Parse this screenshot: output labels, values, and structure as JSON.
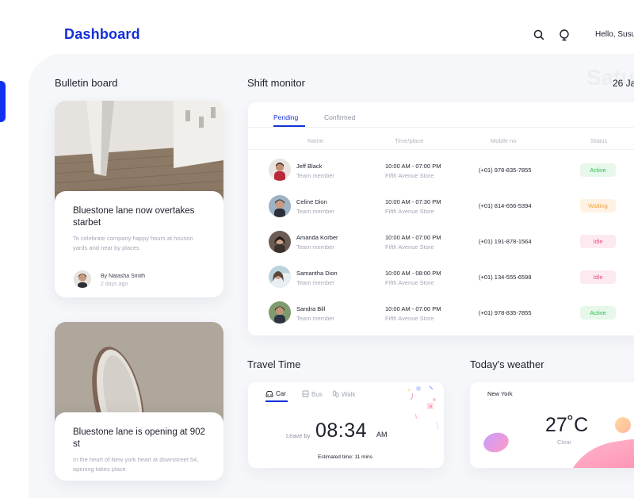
{
  "header": {
    "title": "Dashboard",
    "greeting": "Hello, Susu"
  },
  "bulletin": {
    "title": "Bulletin board",
    "cards": [
      {
        "title": "Bluestone lane now overtakes starbet",
        "excerpt": "To celebrate company happy hours at houson yards and near by places",
        "author": "By Natasha Smith",
        "time": "2 days ago"
      },
      {
        "title": "Bluestone lane is  opening at 902 st",
        "excerpt": "In the heart of New york heart at downstreet 54, opening takes place"
      }
    ]
  },
  "shift": {
    "title": "Shift monitor",
    "day_ghost": "Satu",
    "date": "26 Ja",
    "tabs": [
      "Pending",
      "Confirmed"
    ],
    "columns": [
      "Name",
      "Time/place",
      "Mobile no",
      "Status"
    ],
    "rows": [
      {
        "name": "Jeff Black",
        "role": "Team member",
        "time": "10:00 AM - 07:00 PM",
        "place": "Fifth Avenue Store",
        "phone": "(+01) 978-835-7855",
        "status": "Active",
        "status_type": "active"
      },
      {
        "name": "Celine Dion",
        "role": "Team member",
        "time": "10:00 AM - 07:30 PM",
        "place": "Fifth Avenue Store",
        "phone": "(+01) 814-656-5394",
        "status": "Waiting",
        "status_type": "waiting"
      },
      {
        "name": "Amanda Korber",
        "role": "Team member",
        "time": "10:00 AM - 07:00 PM",
        "place": "Fifth Avenue Store",
        "phone": "(+01) 191-878-1564",
        "status": "Idle",
        "status_type": "idle"
      },
      {
        "name": "Samantha Dion",
        "role": "Team member",
        "time": "10:00 AM - 08:00 PM",
        "place": "Fifth Avenue Store",
        "phone": "(+01) 134-555-6598",
        "status": "Idle",
        "status_type": "idle"
      },
      {
        "name": "Sandra Bill",
        "role": "Team member",
        "time": "10:00 AM - 07:00 PM",
        "place": "Fifth Avenue Store",
        "phone": "(+01) 978-835-7855",
        "status": "Active",
        "status_type": "active"
      }
    ]
  },
  "travel": {
    "title": "Travel Time",
    "modes": [
      "Car",
      "Bus",
      "Walk"
    ],
    "leave_label": "Leave by",
    "leave_time": "08:34",
    "leave_ampm": "AM",
    "estimate": "Estimated time: 11 mins"
  },
  "weather": {
    "title": "Today's weather",
    "city": "New York",
    "temperature": "27˚C",
    "condition": "Clear"
  },
  "colors": {
    "accent": "#1430d8",
    "active": "#2ebd4f",
    "waiting": "#f5a132",
    "idle": "#ef4c7b"
  }
}
